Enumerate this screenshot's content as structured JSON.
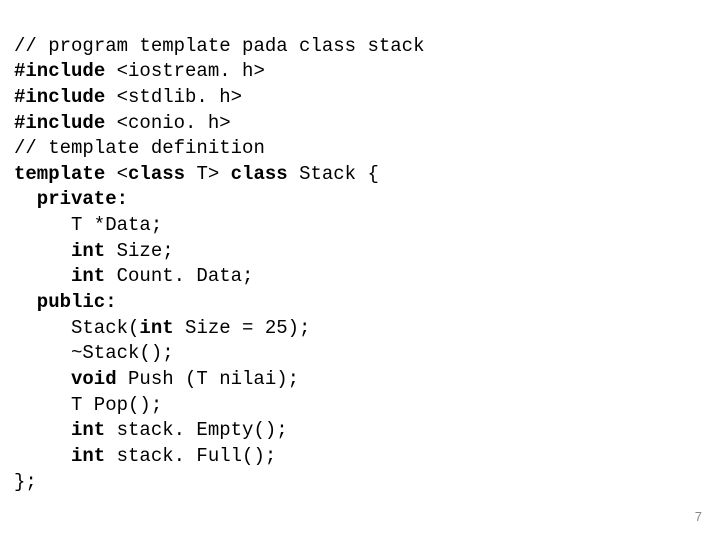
{
  "code": {
    "l1_comment": "// program template pada class stack",
    "l2a": "#include",
    "l2b": " <iostream. h>",
    "l3a": "#include",
    "l3b": " <stdlib. h>",
    "l4a": "#include",
    "l4b": " <conio. h>",
    "l5_comment": "// template definition",
    "l6a": "template",
    "l6b": " <",
    "l6c": "class",
    "l6d": " T> ",
    "l6e": "class",
    "l6f": " Stack {",
    "l7": "private:",
    "l8": "T *Data;",
    "l9a": "int",
    "l9b": " Size;",
    "l10a": "int",
    "l10b": " Count. Data;",
    "l11": "public:",
    "l12a": "Stack(",
    "l12b": "int",
    "l12c": " Size = 25);",
    "l13": "~Stack();",
    "l14a": "void",
    "l14b": " Push (T nilai);",
    "l15": "T Pop();",
    "l16a": "int",
    "l16b": " stack. Empty();",
    "l17a": "int",
    "l17b": " stack. Full();",
    "l18": "};"
  },
  "page_number": "7"
}
